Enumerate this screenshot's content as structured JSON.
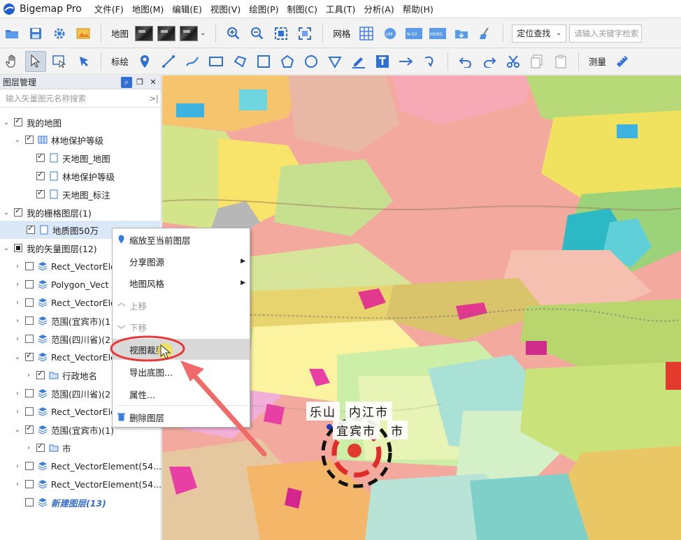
{
  "app": {
    "title": "Bigemap Pro"
  },
  "menu": [
    "文件(F)",
    "地图(M)",
    "编辑(E)",
    "视图(V)",
    "绘图(P)",
    "制图(C)",
    "工具(T)",
    "分析(A)",
    "帮助(H)"
  ],
  "toolbar1": {
    "map_label": "地图",
    "grid_label": "网格",
    "locate_dropdown": "定位查找",
    "search_placeholder": "请输入关键字检索"
  },
  "toolbar2": {
    "annotate_label": "标绘",
    "measure_label": "测量"
  },
  "panel": {
    "title": "图层管理",
    "search_placeholder": "输入矢量图元名称搜索",
    "tree": [
      {
        "label": "我的地图"
      },
      {
        "label": "林地保护等级"
      },
      {
        "label": "天地图_地图"
      },
      {
        "label": "林地保护等级"
      },
      {
        "label": "天地图_标注"
      },
      {
        "label": "我的栅格图层(1)"
      },
      {
        "label": "地质图50万"
      },
      {
        "label": "我的矢量图层(12)"
      },
      {
        "label": "Rect_VectorEle"
      },
      {
        "label": "Polygon_Vect"
      },
      {
        "label": "Rect_VectorEle"
      },
      {
        "label": "范围(宜宾市)(1"
      },
      {
        "label": "范围(四川省)(2"
      },
      {
        "label": "Rect_VectorEle"
      },
      {
        "label": "行政地名"
      },
      {
        "label": "范围(四川省)(2"
      },
      {
        "label": "Rect_VectorEle"
      },
      {
        "label": "范围(宜宾市)(1)"
      },
      {
        "label": "市"
      },
      {
        "label": "Rect_VectorElement(54..."
      },
      {
        "label": "Rect_VectorElement(54..."
      },
      {
        "label": "新建图层(13)"
      }
    ]
  },
  "context_menu": [
    {
      "label": "缩放至当前图层"
    },
    {
      "label": "分享图源"
    },
    {
      "label": "地图风格"
    },
    {
      "label": "上移"
    },
    {
      "label": "下移"
    },
    {
      "label": "视图裁剪"
    },
    {
      "label": "导出底图..."
    },
    {
      "label": "属性..."
    },
    {
      "label": "删除图层"
    }
  ],
  "map": {
    "labels": [
      "乐山",
      "内江市",
      "宜宾市",
      "市"
    ]
  },
  "colors": {
    "accent": "#2f6fd6",
    "annotation": "#e8393a"
  }
}
